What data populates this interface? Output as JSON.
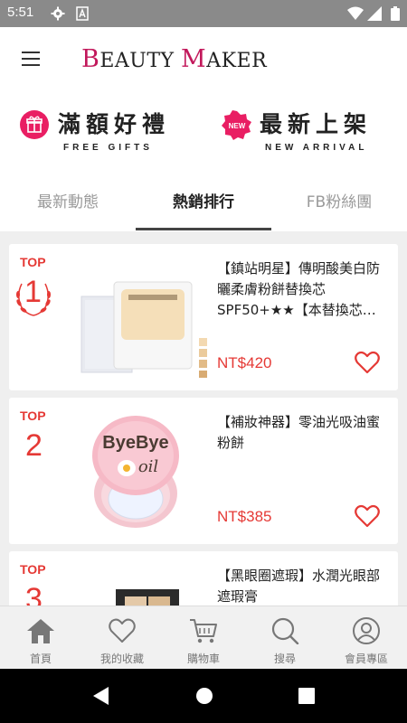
{
  "status_bar": {
    "time": "5:51",
    "icons": [
      "gear-icon",
      "a-icon",
      "wifi-icon",
      "signal-icon",
      "battery-icon"
    ]
  },
  "app": {
    "logo": {
      "cap1": "B",
      "rest1": "EAUTY ",
      "cap2": "M",
      "rest2": "AKER"
    },
    "menu_icon": "hamburger-icon"
  },
  "banners": {
    "gift": {
      "title": "滿額好禮",
      "subtitle": "FREE GIFTS",
      "icon": "gift-icon"
    },
    "new": {
      "title": "最新上架",
      "subtitle": "NEW ARRIVAL",
      "icon": "new-badge-icon",
      "badge_text": "NEW"
    }
  },
  "tabs": [
    {
      "label": "最新動態",
      "active": false
    },
    {
      "label": "熱銷排行",
      "active": true
    },
    {
      "label": "FB粉絲團",
      "active": false
    }
  ],
  "products": [
    {
      "rank_label": "TOP",
      "rank": "1",
      "title": "【鎮站明星】傳明酸美白防曬柔膚粉餅替換芯SPF50+★★【本替換芯…",
      "price": "NT$420",
      "image": "compact-refill-image"
    },
    {
      "rank_label": "TOP",
      "rank": "2",
      "title": "【補妝神器】零油光吸油蜜粉餅",
      "price": "NT$385",
      "image": "byebye-oil-compact-image",
      "image_text": "ByeBye",
      "image_text2": "oil"
    },
    {
      "rank_label": "TOP",
      "rank": "3",
      "title": "【黑眼圈遮瑕】水潤光眼部遮瑕膏",
      "price": "",
      "image": "concealer-image"
    }
  ],
  "bottom_nav": [
    {
      "label": "首頁",
      "icon": "home-icon"
    },
    {
      "label": "我的收藏",
      "icon": "heart-icon"
    },
    {
      "label": "購物車",
      "icon": "cart-icon"
    },
    {
      "label": "搜尋",
      "icon": "search-icon"
    },
    {
      "label": "會員專區",
      "icon": "user-icon"
    }
  ],
  "colors": {
    "accent": "#e53935",
    "brand": "#c2185b",
    "banner_icon": "#e91e63"
  }
}
